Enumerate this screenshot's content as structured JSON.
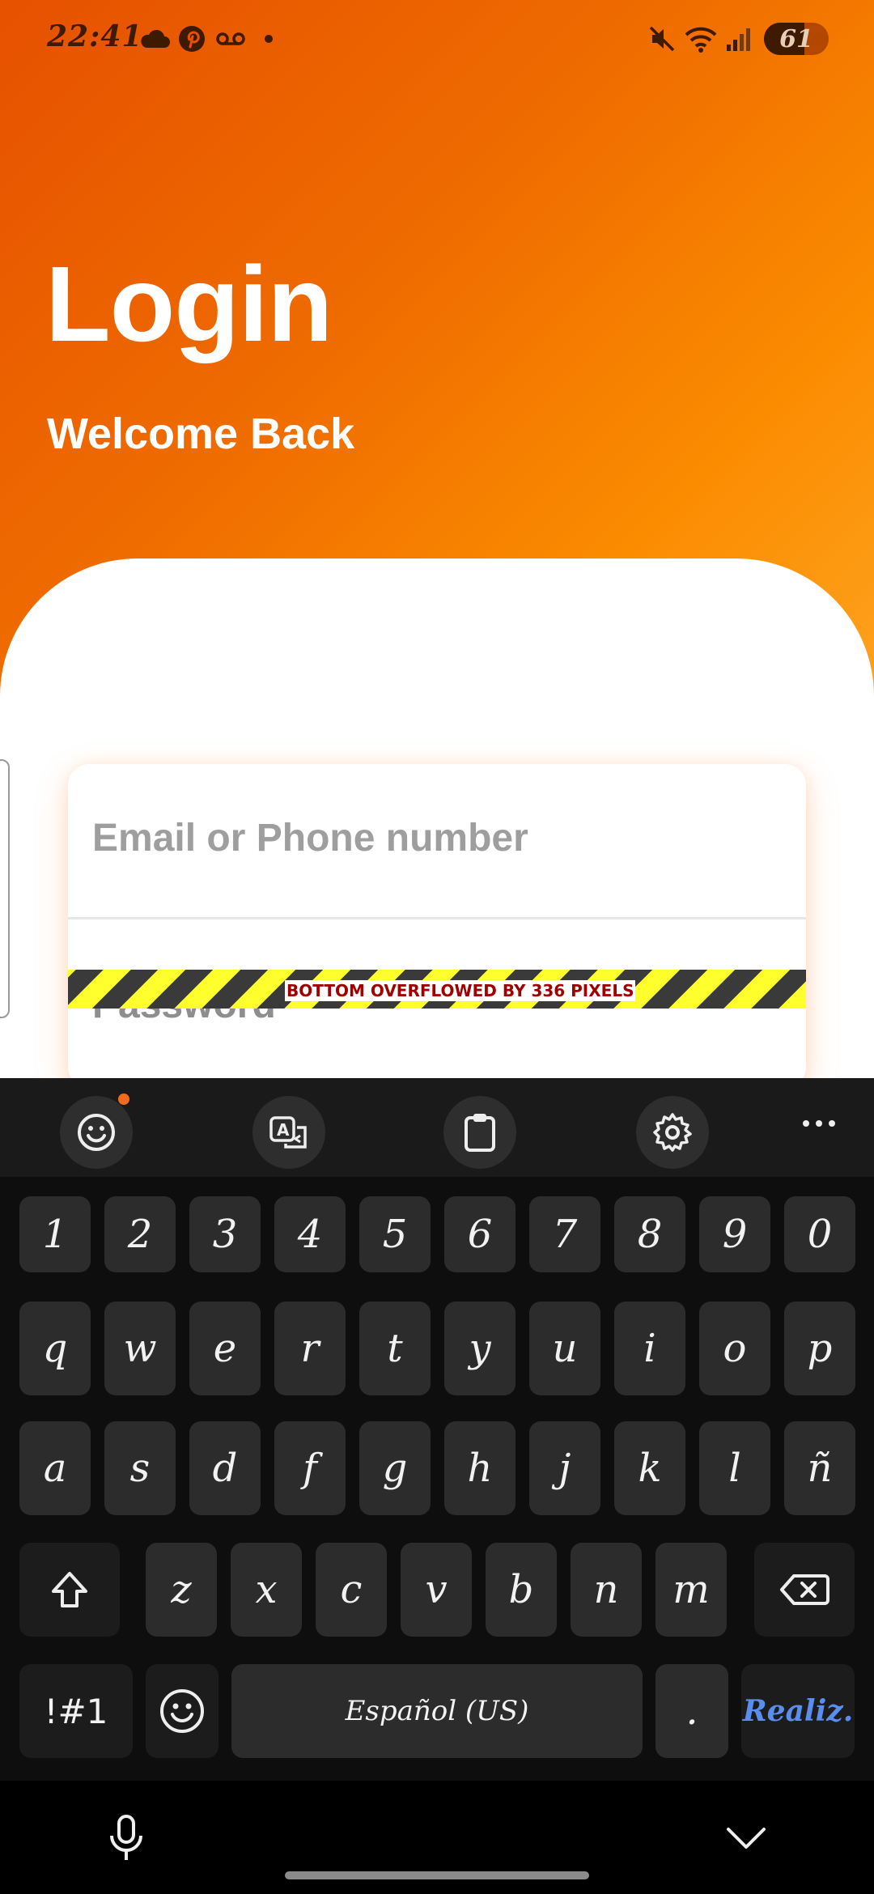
{
  "status_bar": {
    "time": "22:41",
    "battery": "61"
  },
  "login": {
    "title": "Login",
    "subtitle": "Welcome Back",
    "email_placeholder": "Email or Phone number",
    "password_placeholder": "Password",
    "overflow_warning": "BOTTOM OVERFLOWED BY 336 PIXELS"
  },
  "keyboard": {
    "toolbar": [
      "emoji-icon",
      "translate-icon",
      "clipboard-icon",
      "settings-icon",
      "more-icon"
    ],
    "row_numbers": [
      "1",
      "2",
      "3",
      "4",
      "5",
      "6",
      "7",
      "8",
      "9",
      "0"
    ],
    "row_1": [
      "q",
      "w",
      "e",
      "r",
      "t",
      "y",
      "u",
      "i",
      "o",
      "p"
    ],
    "row_2": [
      "a",
      "s",
      "d",
      "f",
      "g",
      "h",
      "j",
      "k",
      "l",
      "ñ"
    ],
    "row_3": [
      "z",
      "x",
      "c",
      "v",
      "b",
      "n",
      "m"
    ],
    "symbols_key": "!#1",
    "space_label": "Español (US)",
    "period_key": ".",
    "action_key": "Realiz."
  },
  "colors": {
    "accent": "#ef6c00",
    "action_text": "#5b8def"
  }
}
